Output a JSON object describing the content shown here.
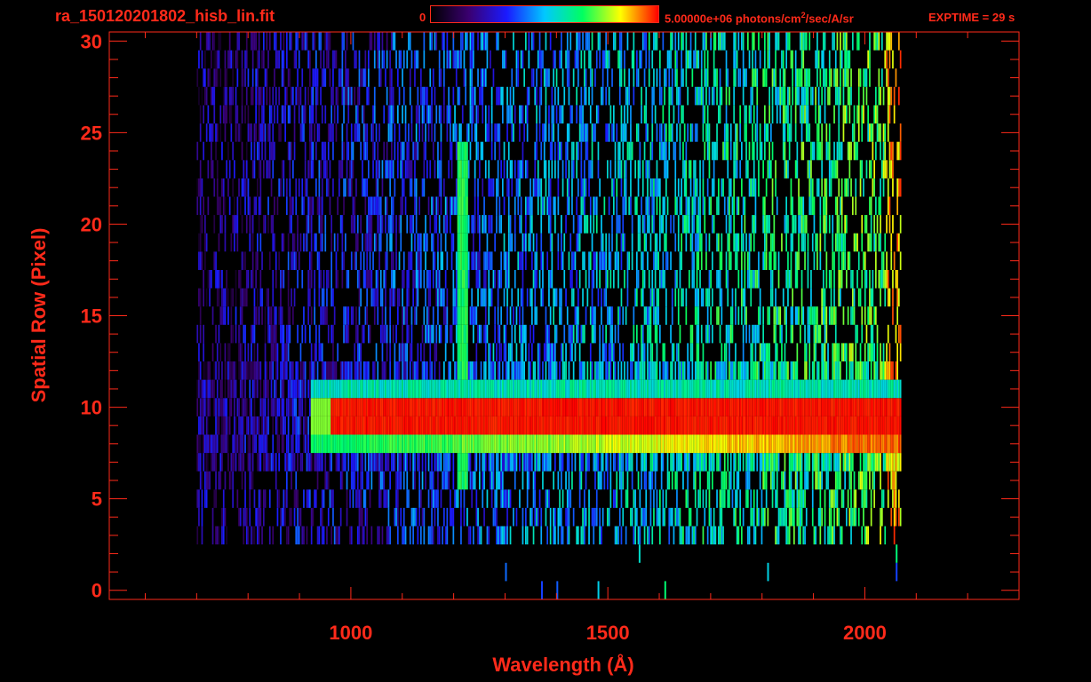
{
  "header": {
    "file_name": "ra_150120201802_hisb_lin.fit",
    "colorbar_min": "0",
    "colorbar_max_pre": "5.00000e+06 photons/cm",
    "colorbar_max_sup": "2",
    "colorbar_max_post": "/sec/A/sr",
    "exptime": "EXPTIME = 29 s"
  },
  "colors": {
    "axis": "#ff2a1a",
    "background": "#000000",
    "colormap": [
      "#000000",
      "#3a0070",
      "#1a1aff",
      "#00c8ff",
      "#00ff60",
      "#ffff00",
      "#ff0000"
    ]
  },
  "chart_data": {
    "type": "heatmap",
    "title": "ra_150120201802_hisb_lin.fit",
    "xlabel": "Wavelength (Å)",
    "ylabel": "Spatial Row (Pixel)",
    "xlim": [
      530,
      2300
    ],
    "ylim": [
      -0.5,
      30.5
    ],
    "x_ticks": [
      1000,
      1500,
      2000
    ],
    "y_ticks": [
      0,
      5,
      10,
      15,
      20,
      25,
      30
    ],
    "x_minor_step": 100,
    "y_minor_step": 1,
    "grid": false,
    "colorbar": {
      "min": 0,
      "max": "5.00000e+06",
      "units": "photons/cm^2/sec/A/sr"
    },
    "data_extent": {
      "x_start": 700,
      "x_end": 2070,
      "rows_with_signal": [
        3,
        30
      ]
    },
    "features": [
      {
        "name": "bright continuum band",
        "rows": [
          8,
          11
        ],
        "x_start": 920,
        "x_end": 2070,
        "level": "high"
      },
      {
        "name": "Lyman-alpha emission column",
        "x": 1216,
        "rows": [
          6,
          24
        ],
        "level": "medium"
      }
    ]
  }
}
